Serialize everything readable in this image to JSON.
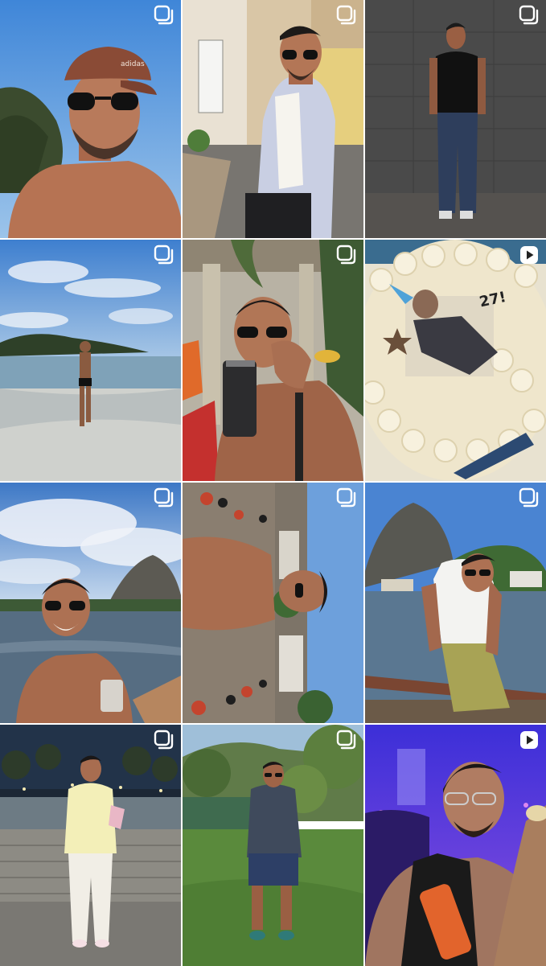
{
  "feed": {
    "tiles": [
      {
        "index": 1,
        "type": "carousel",
        "icon": "carousel-icon",
        "scene": "beach-selfie-cap"
      },
      {
        "index": 2,
        "type": "carousel",
        "icon": "carousel-icon",
        "scene": "street-striped-shirt"
      },
      {
        "index": 3,
        "type": "carousel",
        "icon": "carousel-icon",
        "scene": "wall-black-tee"
      },
      {
        "index": 4,
        "type": "carousel",
        "icon": "carousel-icon",
        "scene": "beach-standing"
      },
      {
        "index": 5,
        "type": "carousel",
        "icon": "carousel-icon",
        "scene": "party-drink"
      },
      {
        "index": 6,
        "type": "reel",
        "icon": "reel-play-icon",
        "scene": "birthday-cake",
        "cake_text": "27!"
      },
      {
        "index": 7,
        "type": "carousel",
        "icon": "carousel-icon",
        "scene": "bay-mountain-smile"
      },
      {
        "index": 8,
        "type": "carousel",
        "icon": "carousel-icon",
        "scene": "rotated-street-party"
      },
      {
        "index": 9,
        "type": "carousel",
        "icon": "carousel-icon",
        "scene": "bay-tank-top"
      },
      {
        "index": 10,
        "type": "carousel",
        "icon": "carousel-icon",
        "scene": "night-white-outfit"
      },
      {
        "index": 11,
        "type": "carousel",
        "icon": "carousel-icon",
        "scene": "garden-denim"
      },
      {
        "index": 12,
        "type": "reel",
        "icon": "reel-play-icon",
        "scene": "purple-concert"
      }
    ]
  },
  "colors": {
    "badge": "#ffffff",
    "sky": "#4d8fd6",
    "skin": "#b8785a",
    "night_purple": "#5a2fd1"
  }
}
